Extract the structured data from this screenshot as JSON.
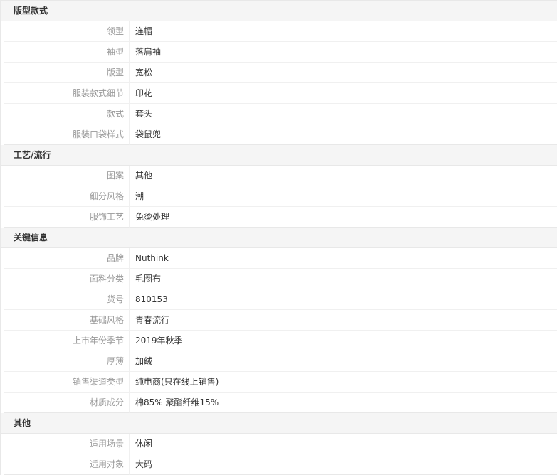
{
  "sections": [
    {
      "title": "版型款式",
      "rows": [
        {
          "key": "领型",
          "value": "连帽"
        },
        {
          "key": "袖型",
          "value": "落肩袖"
        },
        {
          "key": "版型",
          "value": "宽松"
        },
        {
          "key": "服装款式细节",
          "value": "印花"
        },
        {
          "key": "款式",
          "value": "套头"
        },
        {
          "key": "服装口袋样式",
          "value": "袋鼠兜"
        }
      ]
    },
    {
      "title": "工艺/流行",
      "rows": [
        {
          "key": "图案",
          "value": "其他"
        },
        {
          "key": "细分风格",
          "value": "潮"
        },
        {
          "key": "服饰工艺",
          "value": "免烫处理"
        }
      ]
    },
    {
      "title": "关键信息",
      "rows": [
        {
          "key": "品牌",
          "value": "Nuthink"
        },
        {
          "key": "面料分类",
          "value": "毛圈布"
        },
        {
          "key": "货号",
          "value": "810153"
        },
        {
          "key": "基础风格",
          "value": "青春流行"
        },
        {
          "key": "上市年份季节",
          "value": "2019年秋季"
        },
        {
          "key": "厚薄",
          "value": "加绒"
        },
        {
          "key": "销售渠道类型",
          "value": "纯电商(只在线上销售)"
        },
        {
          "key": "材质成分",
          "value": "棉85% 聚酯纤维15%"
        }
      ]
    },
    {
      "title": "其他",
      "rows": [
        {
          "key": "适用场景",
          "value": "休闲"
        },
        {
          "key": "适用对象",
          "value": "大码"
        }
      ]
    }
  ]
}
